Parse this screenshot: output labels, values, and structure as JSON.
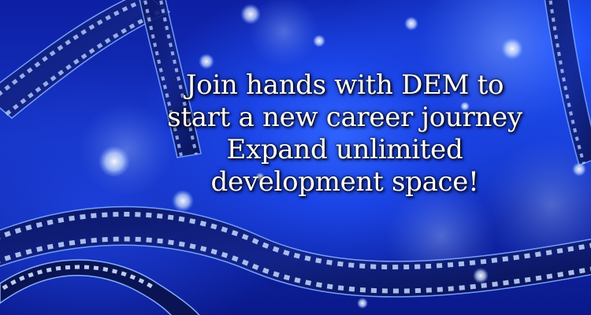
{
  "banner": {
    "lines": [
      "Join hands with DEM to",
      "start a new career journey",
      "Expand unlimited",
      "development space!"
    ]
  },
  "scene": {
    "background_color": "#1533c4",
    "accent_glow": "#3a7bff",
    "bokeh_color": "#dfe8ff",
    "film_color": "#0a1450",
    "film_highlight": "#9fc4ff"
  }
}
